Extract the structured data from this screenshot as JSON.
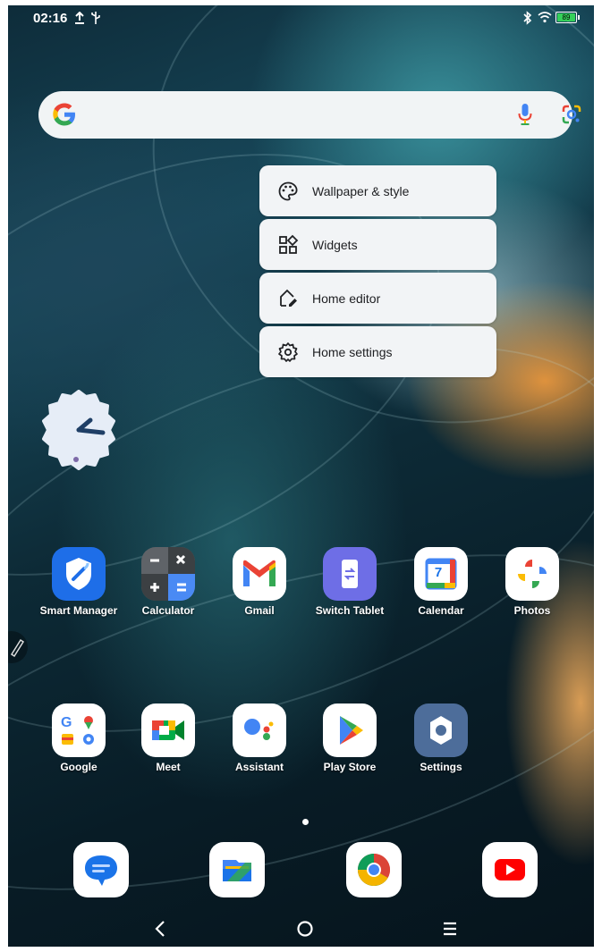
{
  "status_bar": {
    "time": "02:16",
    "battery_level": "89",
    "icons": [
      "upload-icon",
      "usb-icon",
      "bluetooth-icon",
      "wifi-icon",
      "battery-icon"
    ]
  },
  "search_bar": {
    "icons": [
      "google-g-icon",
      "microphone-icon",
      "google-lens-icon"
    ]
  },
  "context_menu": {
    "items": [
      {
        "label": "Wallpaper & style",
        "icon": "palette-icon"
      },
      {
        "label": "Widgets",
        "icon": "widgets-icon"
      },
      {
        "label": "Home editor",
        "icon": "home-edit-icon"
      },
      {
        "label": "Home settings",
        "icon": "gear-icon"
      }
    ]
  },
  "apps_row1": [
    {
      "name": "Smart Manager",
      "icon": "shield-icon"
    },
    {
      "name": "Calculator",
      "icon": "calculator-icon"
    },
    {
      "name": "Gmail",
      "icon": "gmail-icon"
    },
    {
      "name": "Switch Tablet",
      "icon": "switch-tablet-icon"
    },
    {
      "name": "Calendar",
      "icon": "calendar-icon",
      "badge": "7"
    },
    {
      "name": "Photos",
      "icon": "pinwheel-icon"
    }
  ],
  "apps_row2": [
    {
      "name": "Google",
      "icon": "google-folder-icon"
    },
    {
      "name": "Meet",
      "icon": "meet-icon"
    },
    {
      "name": "Assistant",
      "icon": "assistant-icon"
    },
    {
      "name": "Play Store",
      "icon": "play-store-icon"
    },
    {
      "name": "Settings",
      "icon": "settings-gear-icon"
    }
  ],
  "dock": [
    {
      "app": "Messages",
      "icon": "messages-icon"
    },
    {
      "app": "Files",
      "icon": "files-icon"
    },
    {
      "app": "Chrome",
      "icon": "chrome-icon"
    },
    {
      "app": "YouTube",
      "icon": "youtube-icon"
    }
  ],
  "nav_bar": {
    "icons": [
      "back-icon",
      "home-icon",
      "recents-icon"
    ]
  },
  "colors": {
    "accent_blue": "#1a73e8",
    "battery_green": "#35d05a",
    "menu_bg": "#f2f4f6"
  }
}
